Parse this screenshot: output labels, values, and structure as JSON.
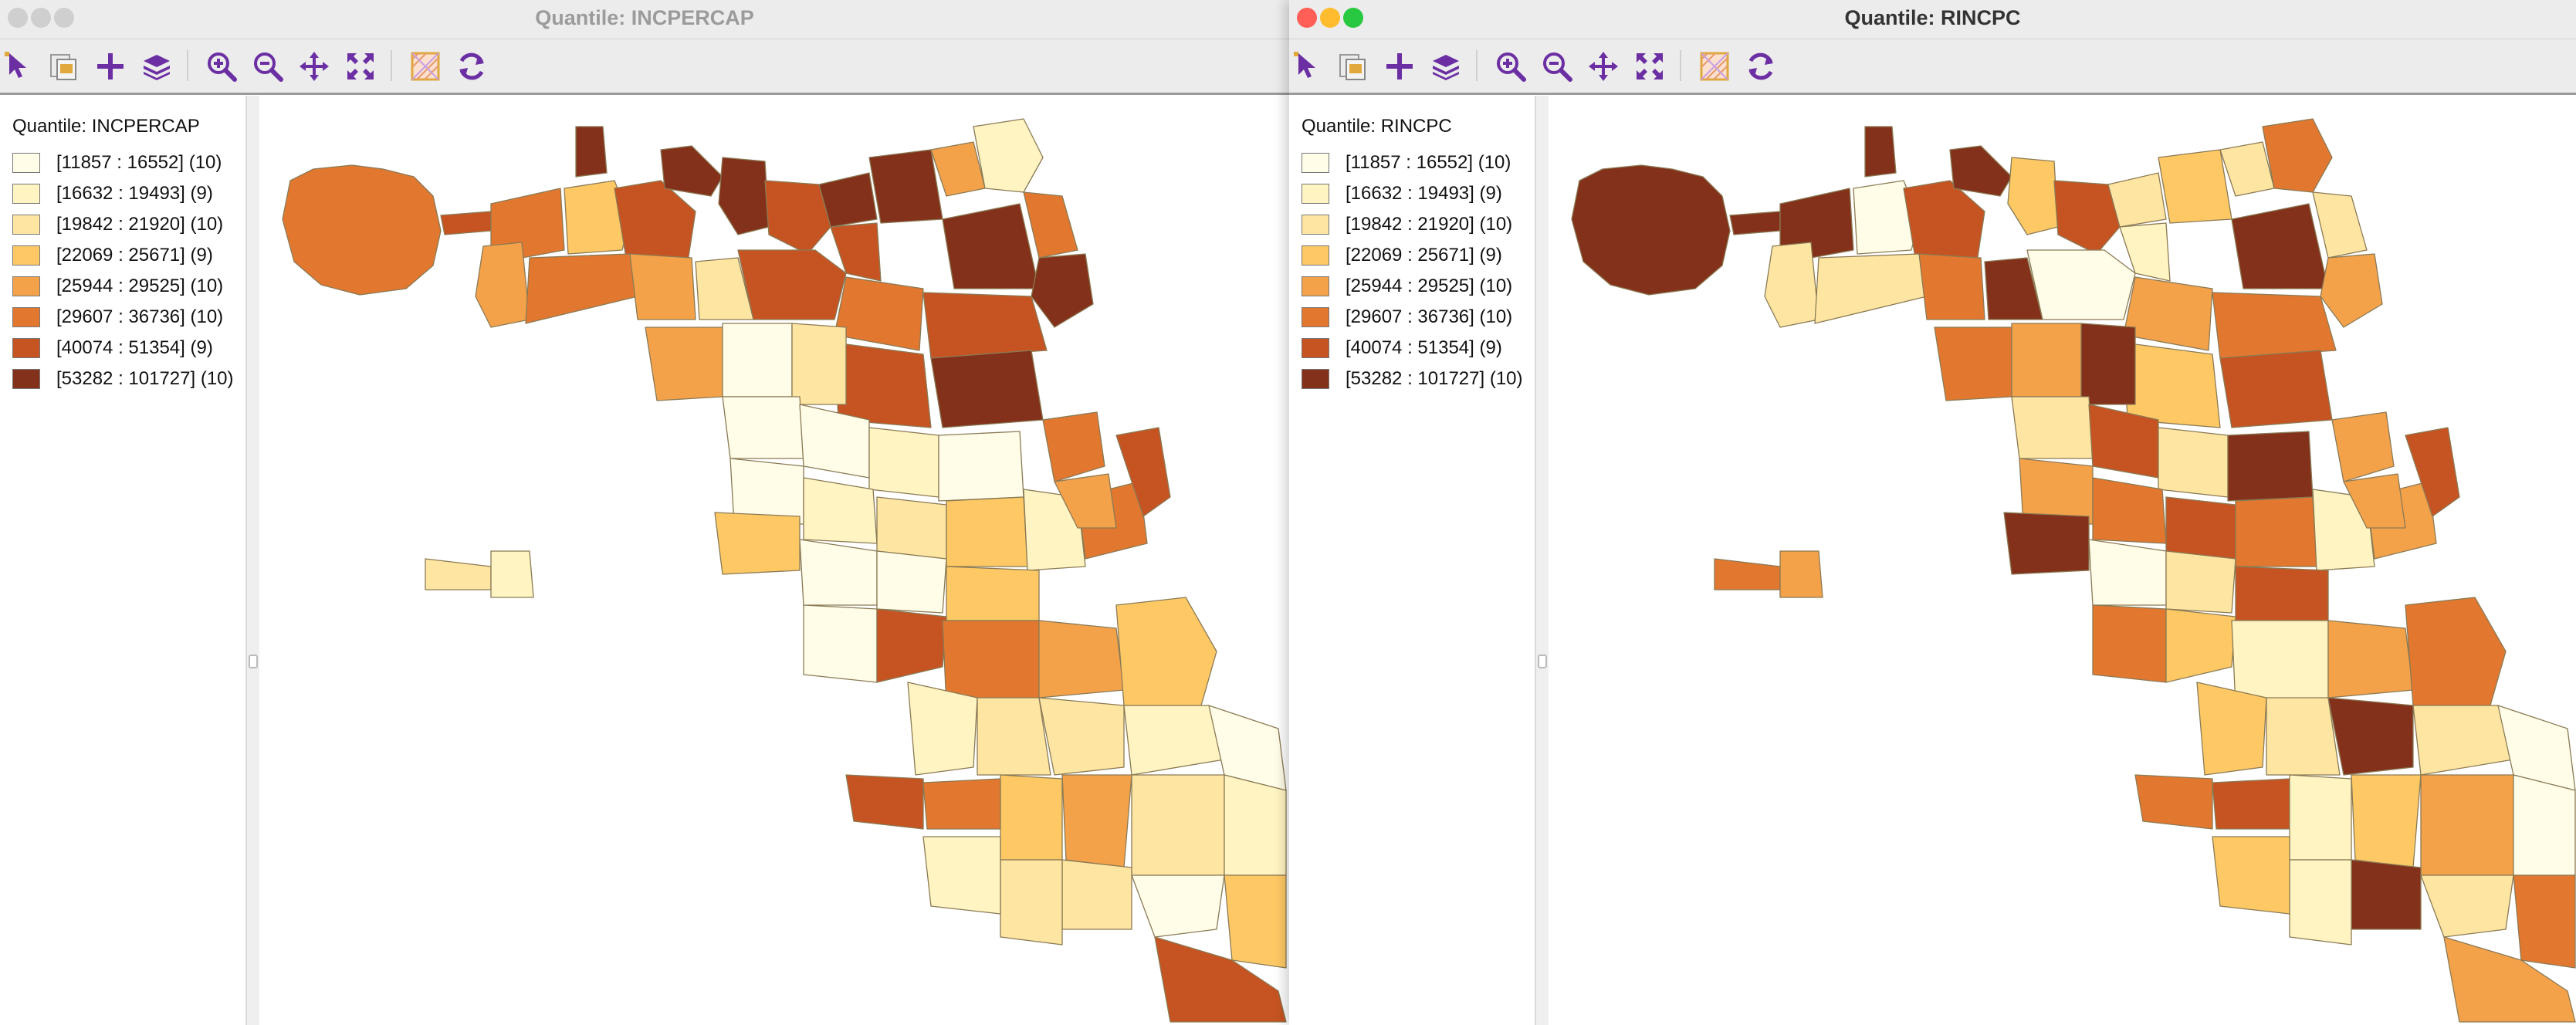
{
  "windows": [
    {
      "id": "left",
      "title": "Quantile: INCPERCAP",
      "active": false,
      "legend_title": "Quantile: INCPERCAP",
      "palette_indices": [
        5,
        6,
        5,
        4,
        3,
        6,
        7,
        7,
        7,
        6,
        5,
        4,
        2,
        6,
        7,
        6,
        7,
        4,
        1,
        7,
        5,
        7,
        5,
        6,
        7,
        6,
        4,
        0,
        2,
        0,
        5,
        0,
        1,
        0,
        0,
        1,
        2,
        3,
        1,
        5,
        6,
        4,
        3,
        0,
        0,
        3,
        2,
        1,
        0,
        6,
        5,
        4,
        3,
        2,
        1,
        0,
        1,
        2,
        5,
        6,
        3,
        4,
        2,
        1,
        0,
        3,
        2,
        6,
        2,
        1
      ]
    },
    {
      "id": "right",
      "title": "Quantile: RINCPC",
      "active": true,
      "legend_title": "Quantile: RINCPC",
      "palette_indices": [
        7,
        7,
        7,
        2,
        0,
        6,
        7,
        7,
        3,
        6,
        2,
        5,
        7,
        0,
        2,
        1,
        3,
        2,
        5,
        7,
        2,
        4,
        4,
        5,
        6,
        3,
        5,
        4,
        7,
        2,
        4,
        6,
        2,
        7,
        4,
        5,
        6,
        5,
        1,
        4,
        6,
        4,
        7,
        0,
        2,
        6,
        5,
        4,
        5,
        3,
        1,
        4,
        5,
        7,
        2,
        0,
        3,
        2,
        6,
        5,
        1,
        3,
        4,
        0,
        2,
        5,
        7,
        4,
        1,
        3
      ]
    }
  ],
  "legend_items": [
    {
      "label": "[11857 : 16552] (10)",
      "color": "#fffde8"
    },
    {
      "label": "[16632 : 19493] (9)",
      "color": "#fff4c2"
    },
    {
      "label": "[19842 : 21920] (10)",
      "color": "#fee6a2"
    },
    {
      "label": "[22069 : 25671] (9)",
      "color": "#fec965"
    },
    {
      "label": "[25944 : 29525] (10)",
      "color": "#f4a24a"
    },
    {
      "label": "[29607 : 36736] (10)",
      "color": "#e2782f"
    },
    {
      "label": "[40074 : 51354] (9)",
      "color": "#c65422"
    },
    {
      "label": "[53282 : 101727] (10)",
      "color": "#83311a"
    }
  ],
  "toolbar_icons": [
    "select-arrow-icon",
    "copy-image-icon",
    "add-plus-icon",
    "layers-icon",
    "zoom-in-icon",
    "zoom-out-icon",
    "pan-move-icon",
    "full-extent-icon",
    "basemap-icon",
    "refresh-icon"
  ],
  "colors": {
    "titlebar": "#ececec",
    "toolbar_icon": "#6b2fa3",
    "tool_icon_accent": "#e0a83d",
    "traffic_close": "#ff5f57",
    "traffic_min": "#febc2e",
    "traffic_max": "#28c840",
    "traffic_inactive": "#cfcfcf",
    "boundary": "#8a7a55"
  }
}
